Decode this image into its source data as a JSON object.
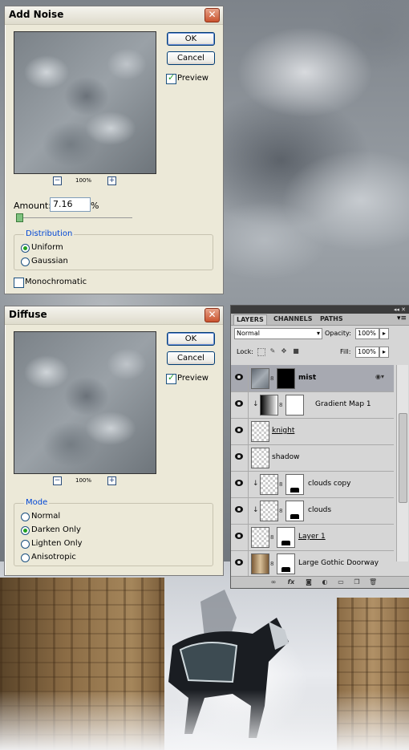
{
  "add_noise": {
    "title": "Add Noise",
    "ok": "OK",
    "cancel": "Cancel",
    "preview_label": "Preview",
    "preview_checked": true,
    "zoom_level": "100%",
    "zoom_minus": "−",
    "zoom_plus": "+",
    "amount_label": "Amount:",
    "amount_value": "7.16",
    "amount_unit": "%",
    "distribution_title": "Distribution",
    "distribution_options": [
      "Uniform",
      "Gaussian"
    ],
    "distribution_selected": "Uniform",
    "monochromatic_label": "Monochromatic",
    "monochromatic_checked": false
  },
  "diffuse": {
    "title": "Diffuse",
    "ok": "OK",
    "cancel": "Cancel",
    "preview_label": "Preview",
    "preview_checked": true,
    "zoom_level": "100%",
    "zoom_minus": "−",
    "zoom_plus": "+",
    "mode_title": "Mode",
    "mode_options": [
      "Normal",
      "Darken Only",
      "Lighten Only",
      "Anisotropic"
    ],
    "mode_selected": "Darken Only"
  },
  "layers_panel": {
    "tabs": [
      "LAYERS",
      "CHANNELS",
      "PATHS"
    ],
    "active_tab": "LAYERS",
    "blend_mode": "Normal",
    "opacity_label": "Opacity:",
    "opacity_value": "100%",
    "lock_label": "Lock:",
    "fill_label": "Fill:",
    "fill_value": "100%",
    "layers": [
      {
        "name": "mist",
        "selected": true,
        "visible": true
      },
      {
        "name": "Gradient Map 1",
        "selected": false,
        "visible": true
      },
      {
        "name": "knight",
        "selected": false,
        "visible": true
      },
      {
        "name": "shadow",
        "selected": false,
        "visible": true
      },
      {
        "name": "clouds copy",
        "selected": false,
        "visible": true
      },
      {
        "name": "clouds",
        "selected": false,
        "visible": true
      },
      {
        "name": "Layer 1",
        "selected": false,
        "visible": true
      },
      {
        "name": "Large Gothic Doorway",
        "selected": false,
        "visible": true
      }
    ]
  }
}
